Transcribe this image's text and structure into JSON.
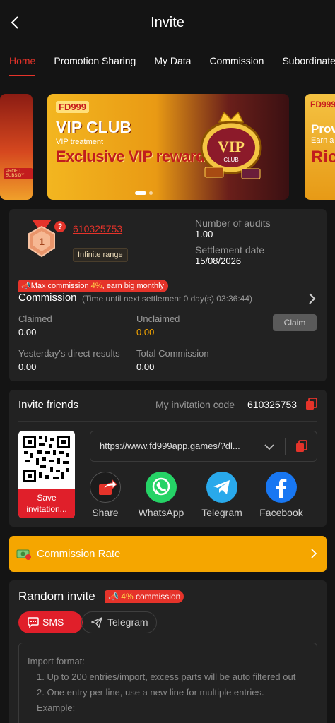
{
  "header": {
    "title": "Invite"
  },
  "tabs": [
    "Home",
    "Promotion Sharing",
    "My Data",
    "Commission",
    "Subordinate"
  ],
  "banner": {
    "logo": "FD999",
    "headline": "VIP CLUB",
    "subline": "VIP treatment",
    "tagline": "Exclusive VIP rewards",
    "badge": "VIP",
    "badge_sub": "CLUB",
    "right_logo": "FD999",
    "right_headline": "Prov",
    "right_sub": "Earn a",
    "right_tag": "Ric",
    "left_tag": "PROFIT SUBSIDY"
  },
  "account": {
    "level": "1",
    "uid": "610325753",
    "range": "Infinite range",
    "audits_label": "Number of audits",
    "audits_value": "1.00",
    "settle_label": "Settlement date",
    "settle_value": "15/08/2026"
  },
  "commission": {
    "tag_prefix": "Max commission ",
    "tag_pct": "4%",
    "tag_suffix": ", earn big monthly",
    "title": "Commission",
    "subtitle": "(Time until next settlement  0 day(s) 03:36:44)",
    "claimed_label": "Claimed",
    "claimed_value": "0.00",
    "unclaimed_label": "Unclaimed",
    "unclaimed_value": "0.00",
    "claim_button": "Claim",
    "yesterday_label": "Yesterday's direct results",
    "yesterday_value": "0.00",
    "total_label": "Total Commission",
    "total_value": "0.00"
  },
  "invite": {
    "title": "Invite friends",
    "code_label": "My invitation code",
    "code": "610325753",
    "save_button": "Save invitation...",
    "link": "https://www.fd999app.games/?dl...",
    "shares": [
      "Share",
      "WhatsApp",
      "Telegram",
      "Facebook"
    ]
  },
  "rate": {
    "label": "Commission Rate"
  },
  "random": {
    "title": "Random invite",
    "tag_pct": "4%",
    "tag_suffix": " commission",
    "sms_button": "SMS",
    "telegram_button": "Telegram",
    "import_title": "Import format:",
    "import_lines": [
      "1. Up to 200 entries/import, excess parts will be auto filtered out",
      "2. One entry per line, use a new line for multiple entries.",
      "Example:"
    ]
  },
  "colors": {
    "accent": "#e5332a",
    "warning": "#f5a600",
    "card": "#222222",
    "background": "#141414"
  }
}
